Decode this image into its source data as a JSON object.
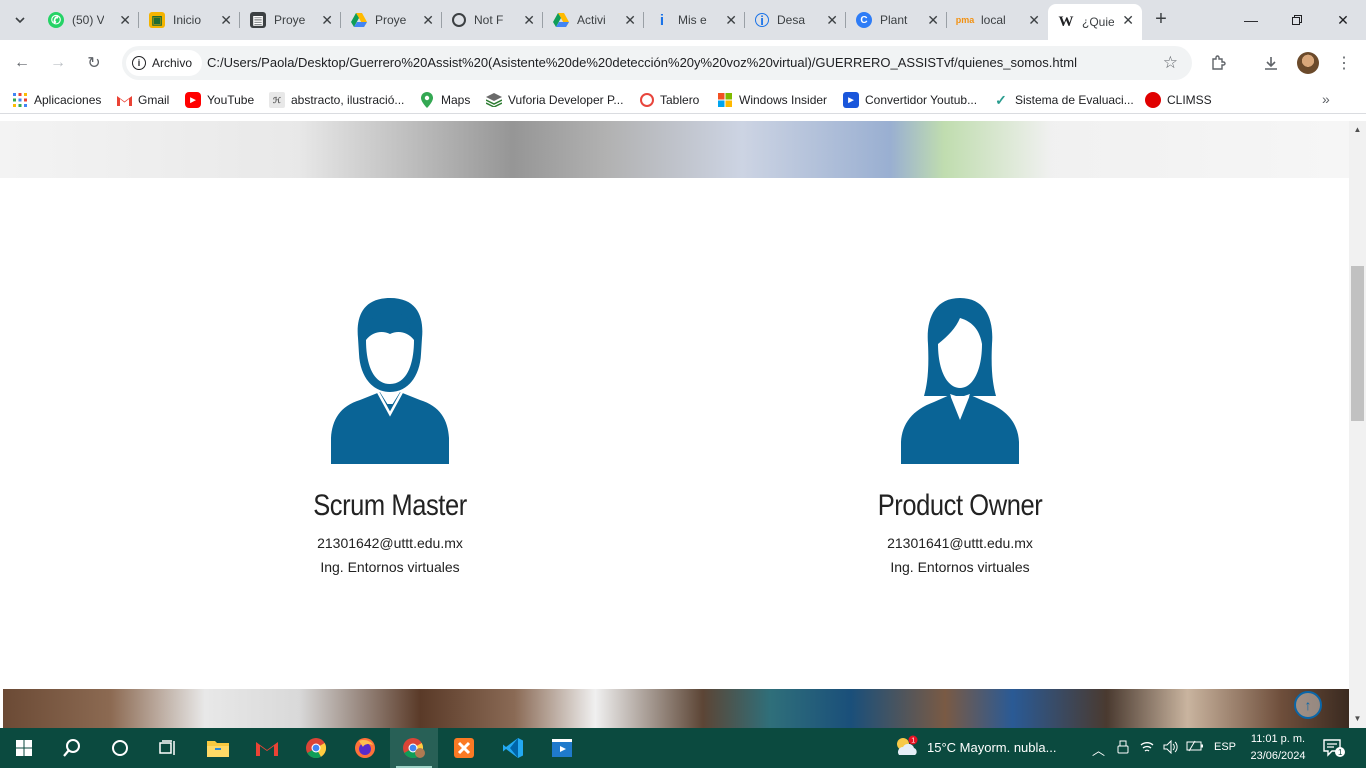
{
  "tabs": [
    {
      "label": "(50) V",
      "icon": "whatsapp-icon",
      "color": "#25d366"
    },
    {
      "label": "Inicio",
      "icon": "classroom-icon",
      "color": "#f4b400"
    },
    {
      "label": "Proye",
      "icon": "contact-card-icon",
      "color": "#3c4043"
    },
    {
      "label": "Proye",
      "icon": "google-drive-icon",
      "color": "#1fa463"
    },
    {
      "label": "Not F",
      "icon": "globe-icon",
      "color": "#3c4043"
    },
    {
      "label": "Activi",
      "icon": "google-drive-icon",
      "color": "#1fa463"
    },
    {
      "label": "Mis e",
      "icon": "info-icon",
      "color": "#1a73e8"
    },
    {
      "label": "Desa",
      "icon": "info-circle-icon",
      "color": "#1a73e8"
    },
    {
      "label": "Plant",
      "icon": "canva-icon",
      "color": "#2e7cf6"
    },
    {
      "label": "local",
      "icon": "phpmyadmin-icon",
      "color": "#f29111"
    },
    {
      "label": "¿Quie",
      "icon": "wix-icon",
      "color": "#202124"
    }
  ],
  "toolbar": {
    "site_chip": "Archivo",
    "url": "C:/Users/Paola/Desktop/Guerrero%20Assist%20(Asistente%20de%20detección%20y%20voz%20virtual)/GUERRERO_ASSISTvf/quienes_somos.html"
  },
  "bookmarks": [
    {
      "label": "Aplicaciones",
      "icon": "apps-grid-icon",
      "color": "#4285f4"
    },
    {
      "label": "Gmail",
      "icon": "gmail-icon",
      "color": "#ea4335"
    },
    {
      "label": "YouTube",
      "icon": "youtube-icon",
      "color": "#ff0000"
    },
    {
      "label": "abstracto, ilustració...",
      "icon": "image-icon",
      "color": "#8a8a8a"
    },
    {
      "label": "Maps",
      "icon": "maps-pin-icon",
      "color": "#34a853"
    },
    {
      "label": "Vuforia Developer P...",
      "icon": "vuforia-icon",
      "color": "#4a4a4a"
    },
    {
      "label": "Tablero",
      "icon": "tablero-icon",
      "color": "#e8453c"
    },
    {
      "label": "Windows Insider",
      "icon": "windows-logo-icon",
      "color": "#00a4ef"
    },
    {
      "label": "Convertidor Youtub...",
      "icon": "converter-icon",
      "color": "#1a56db"
    },
    {
      "label": "Sistema de Evaluaci...",
      "icon": "check-leaf-icon",
      "color": "#2a9d8f"
    },
    {
      "label": "CLIMSS",
      "icon": "climss-icon",
      "color": "#e00000"
    }
  ],
  "team": [
    {
      "role": "Scrum Master",
      "email": "21301642@uttt.edu.mx",
      "career": "Ing. Entornos virtuales",
      "avatar": "male-user-icon"
    },
    {
      "role": "Product Owner",
      "email": "21301641@uttt.edu.mx",
      "career": "Ing. Entornos virtuales",
      "avatar": "female-user-icon"
    }
  ],
  "colors": {
    "avatar": "#0a6496",
    "taskbar": "#0b4a3f"
  },
  "taskbar": {
    "weather": "15°C  Mayorm. nubla...",
    "language": "ESP",
    "time": "11:01 p. m.",
    "date": "23/06/2024",
    "notification_count": "1"
  }
}
